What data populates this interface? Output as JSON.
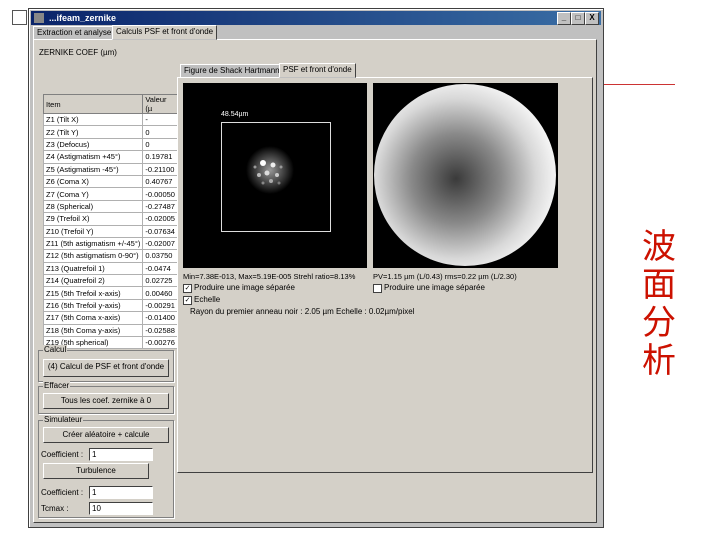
{
  "side_text": [
    "波",
    "面",
    "分",
    "析"
  ],
  "window": {
    "title": "...ifeam_zernike",
    "buttons": [
      "_",
      "□",
      "X"
    ],
    "tabs": [
      "Extraction et analyse",
      "Calculs PSF et front d'onde"
    ],
    "zernike_coef_label": "ZERNIKE COEF (µm)",
    "table": {
      "headers": [
        "Item",
        "Valeur (µ"
      ],
      "rows": [
        [
          "Z1 (Tilt X)",
          "-"
        ],
        [
          "Z2 (Tilt Y)",
          "0"
        ],
        [
          "Z3 (Defocus)",
          "0"
        ],
        [
          "Z4 (Astigmatism +45°)",
          "0.19781"
        ],
        [
          "Z5 (Astigmatism -45°)",
          "-0.21100"
        ],
        [
          "Z6 (Coma X)",
          "0.40767"
        ],
        [
          "Z7 (Coma Y)",
          "-0.00050"
        ],
        [
          "Z8 (Spherical)",
          "-0.27487"
        ],
        [
          "Z9 (Trefoil X)",
          "-0.02005"
        ],
        [
          "Z10 (Trefoil Y)",
          "-0.07634"
        ],
        [
          "Z11 (5th astigmatism +/-45°)",
          "-0.02007"
        ],
        [
          "Z12 (5th astigmatism 0-90°)",
          "0.03750"
        ],
        [
          "Z13 (Quatrefoil 1)",
          "-0.0474"
        ],
        [
          "Z14 (Quatrefoil 2)",
          "0.02725"
        ],
        [
          "Z15 (5th Trefoil x-axis)",
          "0.00460"
        ],
        [
          "Z16 (5th Trefoil y-axis)",
          "-0.00291"
        ],
        [
          "Z17 (5th Coma x-axis)",
          "-0.01400"
        ],
        [
          "Z18 (5th Coma y-axis)",
          "-0.02588"
        ],
        [
          "Z19 (5th spherical)",
          "-0.00276"
        ]
      ]
    },
    "groups": {
      "calcul": {
        "title": "Calcul",
        "button": "(4) Calcul de PSF et front d'onde"
      },
      "effacer": {
        "title": "Effacer",
        "button": "Tous les coef. zernike à 0"
      },
      "simulateur": {
        "title": "Simulateur",
        "button_main": "Créer aléatoire + calcule",
        "coef_label_1": "Coefficient :",
        "coef_value_1": "1",
        "button_turb": "Turbulence",
        "coef_label_2": "Coefficient :",
        "coef_value_2": "1",
        "tcmax_label": "Tcmax :",
        "tcmax_value": "10"
      }
    },
    "right_tabs": [
      "Figure de Shack Hartmann",
      "PSF et front d'onde"
    ],
    "psf_size_label": "48.54µm",
    "psf_stats": "Min=7.38E-013, Max=5.19E-005 Strehl ratio=8.13%",
    "wavefront_stats": "PV=1.15 µm (L/0.43) rms=0.22 µm (L/2.30)",
    "chk_separate_psf": "Produire une image séparée",
    "chk_separate_wf": "Produire une image séparée",
    "chk_echelle": "Echelle",
    "airy_text": "Rayon du premier anneau noir : 2.05 µm Echelle : 0.02µm/pixel",
    "chk_separate_psf_checked": "✓",
    "chk_echelle_checked": "✓"
  }
}
